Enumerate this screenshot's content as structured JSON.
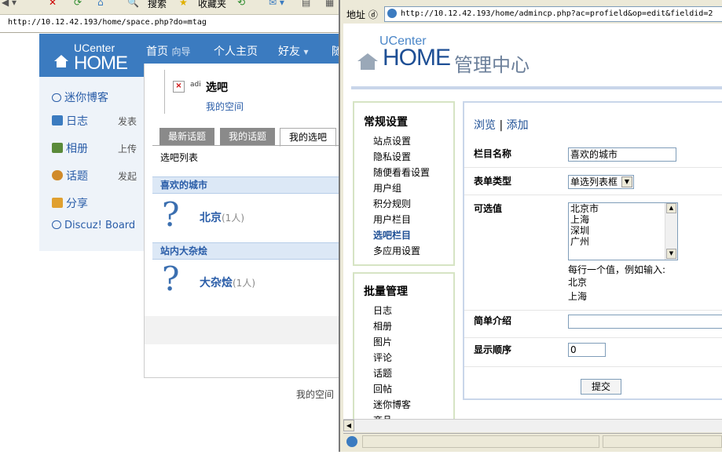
{
  "back_window": {
    "toolbar": {
      "search_label": "搜索",
      "favorites_label": "收藏夹"
    },
    "address_url": "http://10.12.42.193/home/space.php?do=mtag",
    "header": {
      "logo_small": "UCenter",
      "logo_big": "HOME",
      "nav": [
        {
          "label": "首页",
          "sub": "向导"
        },
        {
          "label": "个人主页",
          "sub": ""
        },
        {
          "label": "好友",
          "sub": "▾"
        },
        {
          "label": "随",
          "sub": ""
        }
      ]
    },
    "sidebar": [
      {
        "label": "迷你博客",
        "extra": "",
        "icon": "chat-bubble-icon",
        "color": "#2a5da8"
      },
      {
        "label": "日志",
        "extra": "发表",
        "icon": "notebook-icon",
        "color": "#3b7bc0"
      },
      {
        "label": "相册",
        "extra": "上传",
        "icon": "photo-icon",
        "color": "#5a8a3a"
      },
      {
        "label": "话题",
        "extra": "发起",
        "icon": "people-icon",
        "color": "#d08a2a"
      },
      {
        "label": "分享",
        "extra": "",
        "icon": "folder-icon",
        "color": "#e0a030"
      },
      {
        "label": "Discuz! Board",
        "extra": "",
        "icon": "chat-bubble-icon",
        "color": "#2a5da8"
      }
    ],
    "popup": {
      "title": "选吧",
      "subtitle": "我的空间",
      "img_alt": "adi"
    },
    "tabs": [
      "最新话题",
      "我的话题",
      "我的选吧"
    ],
    "active_tab": 2,
    "list_title": "选吧列表",
    "groups": [
      {
        "header": "喜欢的城市",
        "item": "北京",
        "count": "(1人)"
      },
      {
        "header": "站内大杂烩",
        "item": "大杂烩",
        "count": "(1人)"
      }
    ],
    "footer_text": "我的空间"
  },
  "front_window": {
    "address_label": "地址 ⓓ",
    "address_url": "http://10.12.42.193/home/admincp.php?ac=profield&op=edit&fieldid=2",
    "logo_small": "UCenter",
    "logo_big": "HOME",
    "logo_cn": "管理中心",
    "menu1": {
      "title": "常规设置",
      "items": [
        "站点设置",
        "隐私设置",
        "随便看看设置",
        "用户组",
        "积分规则",
        "用户栏目",
        "选吧栏目",
        "多应用设置"
      ],
      "current": 6
    },
    "menu2": {
      "title": "批量管理",
      "items": [
        "日志",
        "相册",
        "图片",
        "评论",
        "话题",
        "回帖",
        "迷你博客",
        "商品"
      ]
    },
    "form": {
      "head_browse": "浏览",
      "head_sep": "|",
      "head_add": "添加",
      "name_label": "栏目名称",
      "name_value": "喜欢的城市",
      "type_label": "表单类型",
      "type_value": "单选列表框",
      "options_label": "可选值",
      "options": [
        "北京市",
        "上海",
        "深圳",
        "广州"
      ],
      "hint_line1": "每行一个值，例如输入:",
      "hint_line2": "北京",
      "hint_line3": "上海",
      "intro_label": "简单介绍",
      "intro_value": "",
      "order_label": "显示顺序",
      "order_value": "0",
      "submit_label": "提交"
    }
  }
}
